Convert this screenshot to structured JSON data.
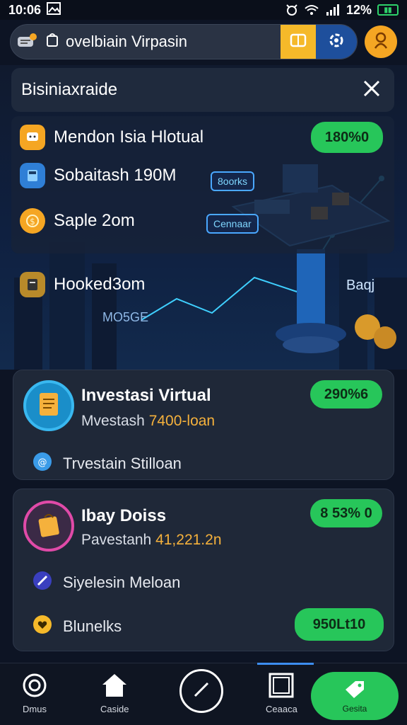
{
  "status_bar": {
    "time": "10:06",
    "battery_percent": "12%"
  },
  "search": {
    "value": "ovelbiain Virpasin"
  },
  "hero": {
    "title": "Bisiniaxraide",
    "badge": "180%0",
    "rows": [
      {
        "label": "Mendon Isia Hlotual"
      },
      {
        "label": "Sobaitash 190M"
      },
      {
        "label": "Saple 2om"
      },
      {
        "label": "Hooked3om"
      }
    ],
    "deco_labels": [
      "8oorks",
      "Cennaar",
      "Baqj",
      "MO5GE"
    ]
  },
  "cards": [
    {
      "title": "Investasi Virtual",
      "subtitle_prefix": "Mvestash ",
      "subtitle_highlight": "7400-loan",
      "badge": "290%6",
      "row": "Trvestain Stilloan"
    },
    {
      "title": "Ibay Doiss",
      "subtitle_prefix": "Pavestanh ",
      "subtitle_highlight": "41,221.2n",
      "badge": "8 53% 0",
      "row1": "Siyelesin Meloan",
      "row2": "Blunelks",
      "action": "950Lt10"
    }
  ],
  "nav": {
    "items": [
      "Dmus",
      "Caside",
      "Ceaaca"
    ],
    "active": "Gesita"
  },
  "colors": {
    "accent_green": "#27c65a",
    "accent_yellow": "#f5b92a",
    "accent_blue": "#1e4f9c",
    "highlight_orange": "#f5b13c",
    "background": "#0d1424"
  },
  "icons": [
    "chat-icon",
    "bag-icon",
    "map-icon",
    "settings-icon",
    "profile-icon",
    "close-icon",
    "coin-icon",
    "home-icon",
    "compass-icon",
    "square-icon",
    "tag-icon"
  ]
}
